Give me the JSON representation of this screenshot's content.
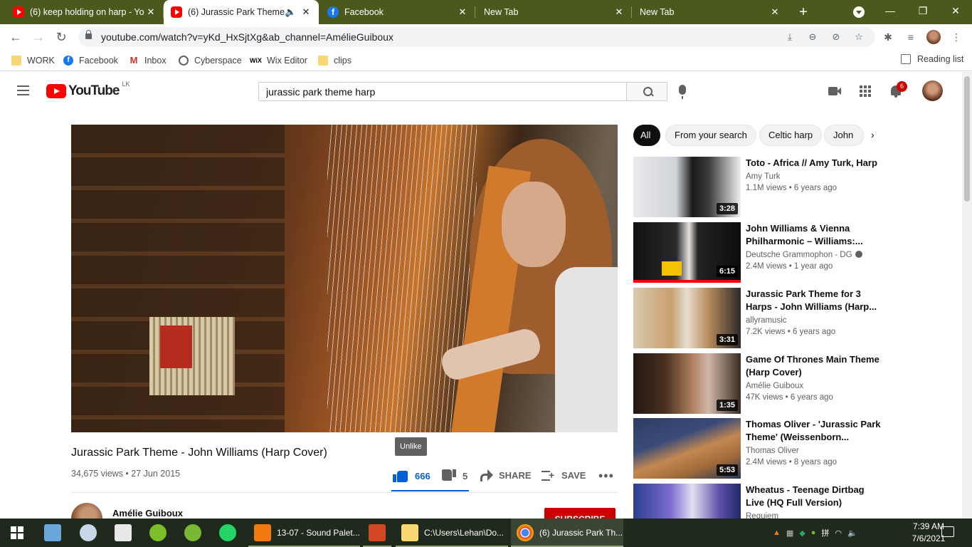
{
  "browser": {
    "tabs": [
      {
        "title": "(6) keep holding on harp - Yo",
        "icon": "youtube-icon"
      },
      {
        "title": "(6) Jurassic Park Theme - ",
        "icon": "youtube-icon",
        "audio_icon": "🔈"
      },
      {
        "title": "Facebook",
        "icon": "facebook-icon"
      },
      {
        "title": "New Tab"
      },
      {
        "title": "New Tab"
      }
    ],
    "close_glyph": "✕",
    "new_tab_glyph": "+",
    "url": "youtube.com/watch?v=yKd_HxSjtXg&ab_channel=AmélieGuiboux",
    "bookmarks": [
      {
        "label": "WORK",
        "icon": "folder-icon"
      },
      {
        "label": "Facebook",
        "icon": "facebook-icon"
      },
      {
        "label": "Inbox",
        "icon": "gmail-icon"
      },
      {
        "label": "Cyberspace",
        "icon": "globe-icon"
      },
      {
        "label": "Wix Editor",
        "icon": "wix-icon"
      },
      {
        "label": "clips",
        "icon": "folder-icon"
      }
    ],
    "reading_list": "Reading list",
    "gmail_glyph": "M",
    "wix_glyph": "WiX",
    "fb_glyph": "f"
  },
  "youtube": {
    "logo_text": "YouTube",
    "country_code": "LK",
    "search_value": "jurassic park theme harp",
    "notification_count": "6",
    "video": {
      "title": "Jurassic Park Theme - John Williams (Harp Cover)",
      "stats": "34,675 views • 27 Jun 2015",
      "likes": "666",
      "dislikes": "5",
      "share_label": "SHARE",
      "save_label": "SAVE",
      "more_label": "•••",
      "tooltip": "Unlike",
      "channel": "Amélie Guiboux",
      "subscribe_label": "SUBSCRIBE"
    },
    "chips": [
      "All",
      "From your search",
      "Celtic harp",
      "John"
    ],
    "chip_next": "›",
    "related": [
      {
        "title": "Toto - Africa // Amy Turk, Harp",
        "channel": "Amy Turk",
        "meta": "1.1M views • 6 years ago",
        "duration": "3:28"
      },
      {
        "title": "John Williams & Vienna Philharmonic – Williams:...",
        "channel": "Deutsche Grammophon - DG",
        "meta": "2.4M views • 1 year ago",
        "duration": "6:15",
        "verified": true
      },
      {
        "title": "Jurassic Park Theme for 3 Harps - John Williams (Harp...",
        "channel": "allyramusic",
        "meta": "7.2K views • 6 years ago",
        "duration": "3:31"
      },
      {
        "title": "Game Of Thrones Main Theme (Harp Cover)",
        "channel": "Amélie Guiboux",
        "meta": "47K views • 6 years ago",
        "duration": "1:35"
      },
      {
        "title": "Thomas Oliver - 'Jurassic Park Theme' (Weissenborn...",
        "channel": "Thomas Oliver",
        "meta": "2.4M views • 8 years ago",
        "duration": "5:53"
      },
      {
        "title": "Wheatus - Teenage Dirtbag Live (HQ Full Version) Origina...",
        "channel": "Requiem",
        "meta": "",
        "duration": ""
      }
    ]
  },
  "taskbar": {
    "items": [
      {
        "label": "13-07 - Sound Palet...",
        "color": "#f07a10"
      },
      {
        "label": "",
        "color": "#d24726"
      },
      {
        "label": "C:\\Users\\Lehan\\Do...",
        "color": "#f8d775"
      },
      {
        "label": "(6) Jurassic Park Th...",
        "color": "#4285f4"
      }
    ],
    "tray_lang": "拼",
    "time": "7:39 AM",
    "date": "7/6/2021"
  }
}
